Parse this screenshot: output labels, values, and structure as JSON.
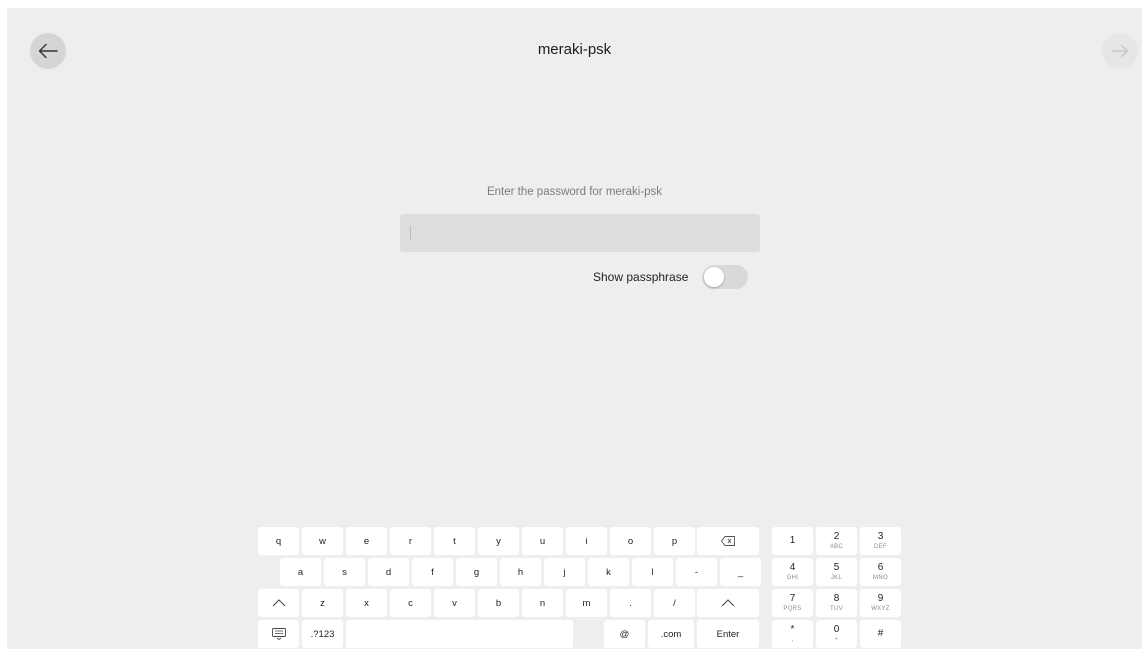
{
  "header": {
    "title": "meraki-psk",
    "back_icon": "arrow-left-icon",
    "next_icon": "arrow-right-icon"
  },
  "form": {
    "prompt": "Enter the password for meraki-psk",
    "password_value": "",
    "show_passphrase_label": "Show passphrase",
    "show_passphrase_on": false
  },
  "keyboard": {
    "row1": [
      "q",
      "w",
      "e",
      "r",
      "t",
      "y",
      "u",
      "i",
      "o",
      "p"
    ],
    "row2": [
      "a",
      "s",
      "d",
      "f",
      "g",
      "h",
      "j",
      "k",
      "l",
      "-",
      "_"
    ],
    "row3": [
      "z",
      "x",
      "c",
      "v",
      "b",
      "n",
      "m",
      ".",
      "/"
    ],
    "backspace_icon": "backspace-icon",
    "shift_icon": "shift-icon",
    "hide_keyboard_icon": "keyboard-hide-icon",
    "symbols_label": ".?123",
    "at_label": "@",
    "dotcom_label": ".com",
    "enter_label": "Enter",
    "numpad": [
      {
        "n": "1",
        "s": ""
      },
      {
        "n": "2",
        "s": "ABC"
      },
      {
        "n": "3",
        "s": "DEF"
      },
      {
        "n": "4",
        "s": "GHI"
      },
      {
        "n": "5",
        "s": "JKL"
      },
      {
        "n": "6",
        "s": "MNO"
      },
      {
        "n": "7",
        "s": "PQRS"
      },
      {
        "n": "8",
        "s": "TUV"
      },
      {
        "n": "9",
        "s": "WXYZ"
      },
      {
        "n": "*",
        "s": ","
      },
      {
        "n": "0",
        "s": "+"
      },
      {
        "n": "#",
        "s": ""
      }
    ]
  }
}
